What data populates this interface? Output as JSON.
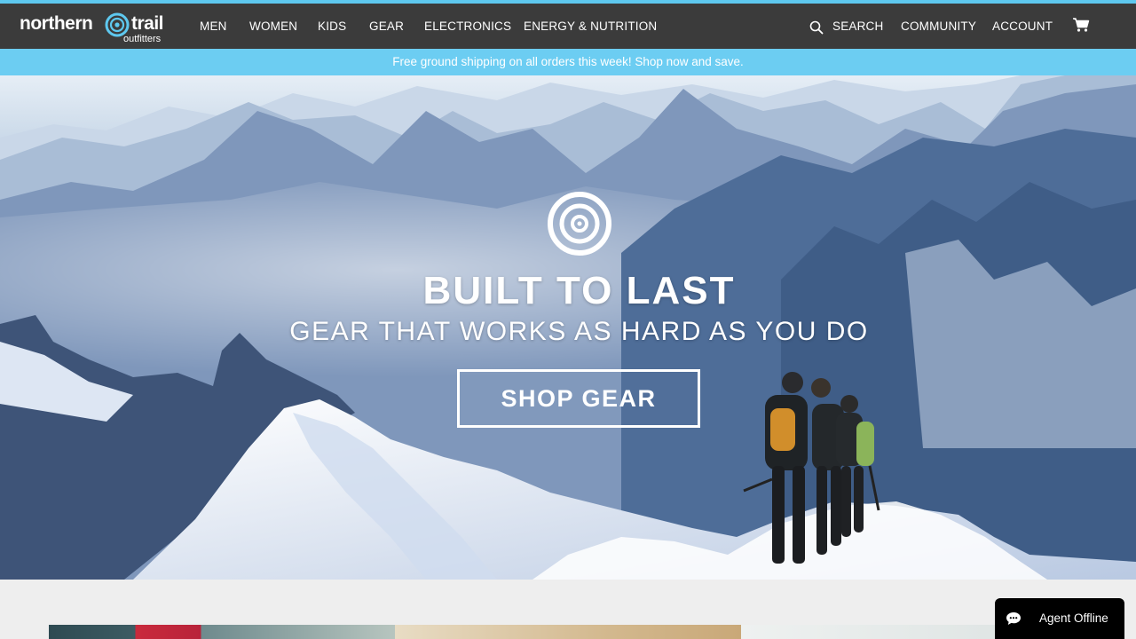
{
  "header": {
    "logo": {
      "word1": "northern",
      "word2": "trail",
      "tagline": "outfitters"
    },
    "nav": [
      {
        "label": "MEN"
      },
      {
        "label": "WOMEN"
      },
      {
        "label": "KIDS"
      },
      {
        "label": "GEAR"
      },
      {
        "label": "ELECTRONICS"
      },
      {
        "label": "ENERGY & NUTRITION"
      }
    ],
    "utility": {
      "search_label": "SEARCH",
      "community_label": "COMMUNITY",
      "account_label": "ACCOUNT",
      "search_icon": "search-icon",
      "cart_icon": "cart-icon"
    }
  },
  "promo_banner": {
    "text": "Free ground shipping on all orders this week! Shop now and save."
  },
  "hero": {
    "title": "BUILT TO LAST",
    "subtitle": "GEAR THAT WORKS AS HARD AS YOU DO",
    "cta_label": "SHOP GEAR",
    "logo_icon": "brand-ring-icon"
  },
  "chat": {
    "label": "Agent Offline",
    "icon": "chat-bubble-icon"
  },
  "colors": {
    "nav_background": "#3b3b3b",
    "promo_background": "#6ccdf2",
    "accent_stripe": "#5ec8ef",
    "page_background": "#eeeeee",
    "chat_background": "#000000"
  }
}
